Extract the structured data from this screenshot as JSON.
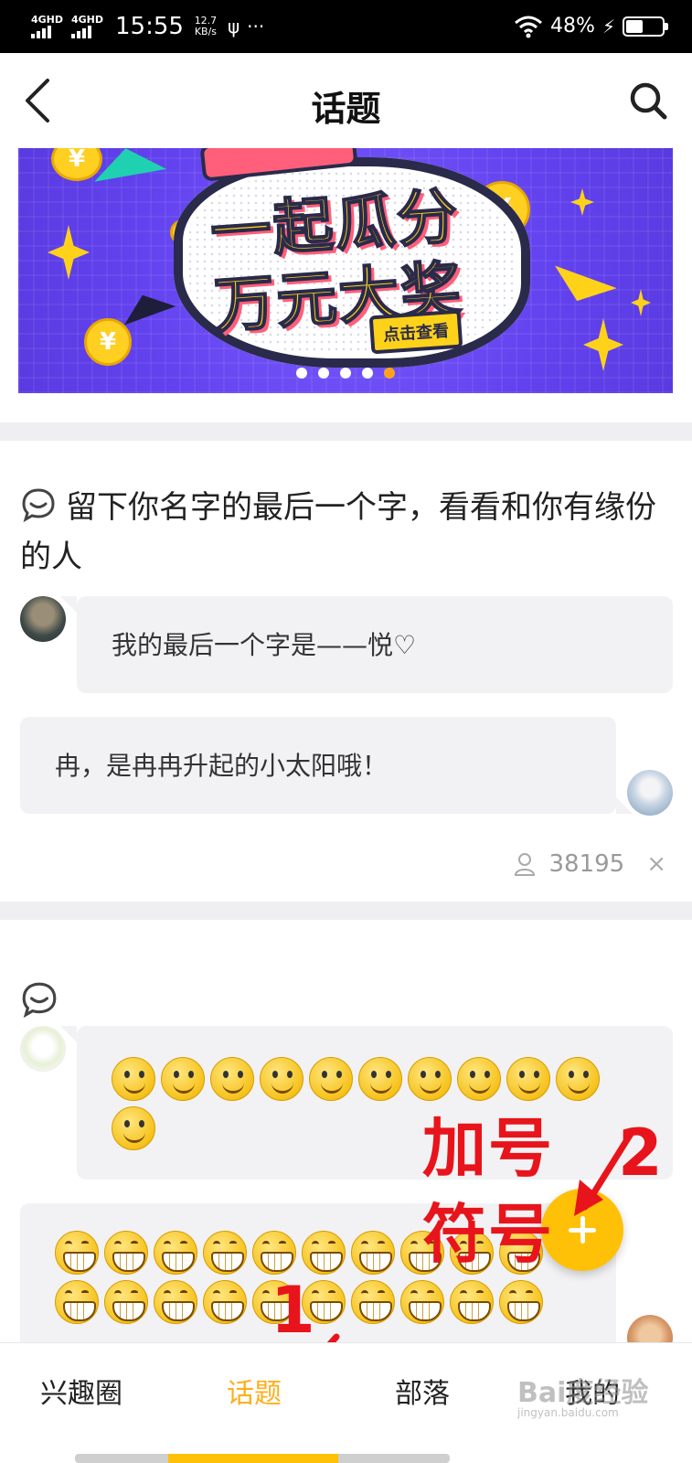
{
  "status_bar": {
    "signal1": "4GHD",
    "signal2": "4GHD",
    "time": "15:55",
    "speed_value": "12.7",
    "speed_unit": "KB/s",
    "battery_pct": "48%",
    "battery_level": 0.48
  },
  "header": {
    "title": "话题"
  },
  "banner": {
    "line1": "一起瓜分",
    "line2": "万元大奖",
    "button": "点击查看",
    "coin_symbol": "¥",
    "slide_count": 5,
    "active_slide": 5
  },
  "topic1": {
    "title": "留下你名字的最后一个字，看看和你有缘份的人",
    "reply1": "我的最后一个字是——悦♡",
    "reply2": "冉，是冉冉升起的小太阳哦！",
    "views": "38195",
    "close": "×"
  },
  "topic2": {
    "smile_count": 11,
    "grin_count": 20
  },
  "annotations": {
    "label_line1": "加号",
    "label_line2": "符号",
    "num2": "2",
    "num1": "1"
  },
  "tabs": [
    {
      "label": "兴趣圈",
      "active": false
    },
    {
      "label": "话题",
      "active": true
    },
    {
      "label": "部落",
      "active": false
    },
    {
      "label": "我的",
      "active": false
    }
  ],
  "watermark": {
    "text": "Bai度经验",
    "sub": "jingyan.baidu.com"
  },
  "colors": {
    "accent": "#ffc107",
    "tab_active": "#ffae1a",
    "annotation": "#e8141c",
    "banner_bg": "#6a4cf2"
  }
}
